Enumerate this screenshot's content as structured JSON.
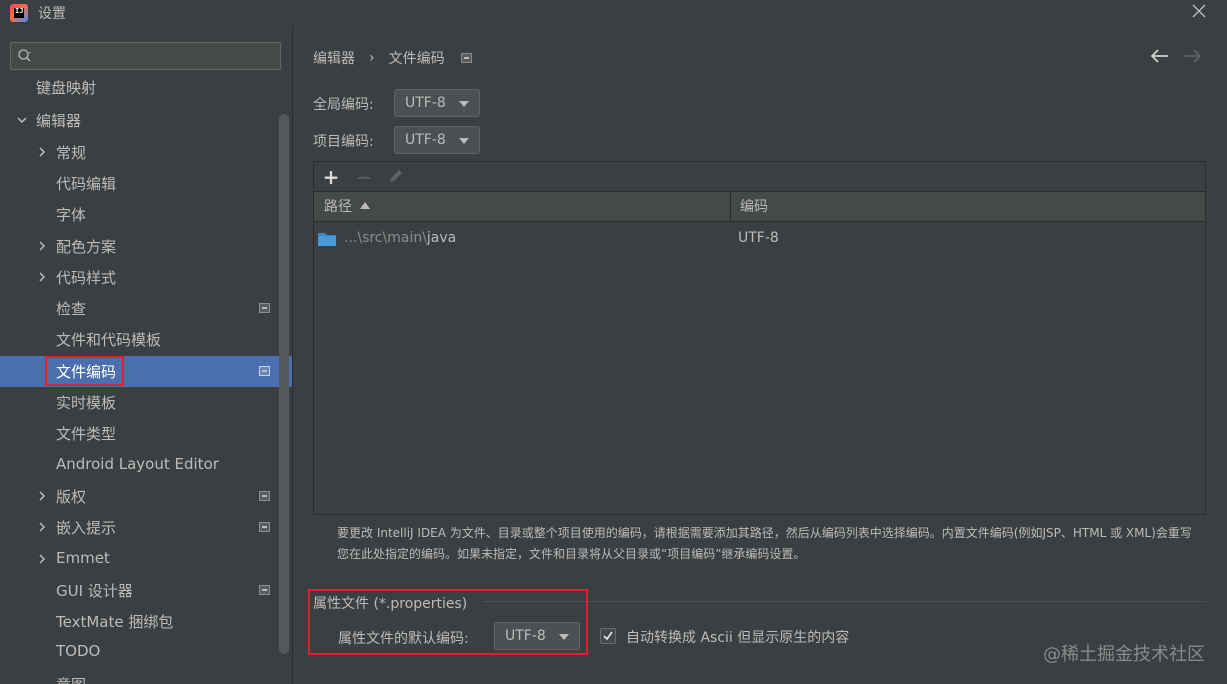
{
  "window": {
    "title": "设置",
    "app_icon_text": "IJ"
  },
  "sidebar": {
    "search_placeholder": "",
    "items": [
      {
        "label": "键盘映射",
        "level": 0,
        "expandable": false,
        "badge": false
      },
      {
        "label": "编辑器",
        "level": 0,
        "expandable": true,
        "expanded": true,
        "badge": false
      },
      {
        "label": "常规",
        "level": 1,
        "expandable": true,
        "badge": false
      },
      {
        "label": "代码编辑",
        "level": 1,
        "expandable": false,
        "badge": false
      },
      {
        "label": "字体",
        "level": 1,
        "expandable": false,
        "badge": false
      },
      {
        "label": "配色方案",
        "level": 1,
        "expandable": true,
        "badge": false
      },
      {
        "label": "代码样式",
        "level": 1,
        "expandable": true,
        "badge": false
      },
      {
        "label": "检查",
        "level": 1,
        "expandable": false,
        "badge": true
      },
      {
        "label": "文件和代码模板",
        "level": 1,
        "expandable": false,
        "badge": false
      },
      {
        "label": "文件编码",
        "level": 1,
        "expandable": false,
        "badge": true,
        "selected": true
      },
      {
        "label": "实时模板",
        "level": 1,
        "expandable": false,
        "badge": false
      },
      {
        "label": "文件类型",
        "level": 1,
        "expandable": false,
        "badge": false
      },
      {
        "label": "Android Layout Editor",
        "level": 1,
        "expandable": false,
        "badge": false
      },
      {
        "label": "版权",
        "level": 1,
        "expandable": true,
        "badge": true
      },
      {
        "label": "嵌入提示",
        "level": 1,
        "expandable": true,
        "badge": true
      },
      {
        "label": "Emmet",
        "level": 1,
        "expandable": true,
        "badge": false
      },
      {
        "label": "GUI 设计器",
        "level": 1,
        "expandable": false,
        "badge": true
      },
      {
        "label": "TextMate 捆绑包",
        "level": 1,
        "expandable": false,
        "badge": false
      },
      {
        "label": "TODO",
        "level": 1,
        "expandable": false,
        "badge": false
      },
      {
        "label": "意图",
        "level": 1,
        "expandable": false,
        "badge": false
      }
    ]
  },
  "main": {
    "breadcrumb": {
      "parent": "编辑器",
      "separator": "›",
      "current": "文件编码"
    },
    "global_encoding": {
      "label": "全局编码:",
      "value": "UTF-8"
    },
    "project_encoding": {
      "label": "项目编码:",
      "value": "UTF-8"
    },
    "table": {
      "columns": [
        "路径",
        "编码"
      ],
      "rows": [
        {
          "path_prefix": "...\\src\\main\\",
          "path_last": "java",
          "encoding": "UTF-8"
        }
      ],
      "toolbar": {
        "add": "+",
        "remove": "−",
        "edit": "✎"
      }
    },
    "description": "要更改 IntelliJ IDEA 为文件、目录或整个项目使用的编码，请根据需要添加其路径，然后从编码列表中选择编码。内置文件编码(例如JSP、HTML 或 XML)会重写您在此处指定的编码。如果未指定，文件和目录将从父目录或“项目编码”继承编码设置。",
    "properties": {
      "section_title": "属性文件 (*.properties)",
      "default_label": "属性文件的默认编码:",
      "default_value": "UTF-8",
      "ascii_checkbox_label": "自动转换成 Ascii 但显示原生的内容",
      "ascii_checked": true
    }
  },
  "watermark": "@稀土掘金技术社区",
  "colors": {
    "background": "#3c3f41",
    "selection": "#4b6eaf",
    "highlight_box": "#e0202a",
    "folder": "#3d86c6"
  }
}
